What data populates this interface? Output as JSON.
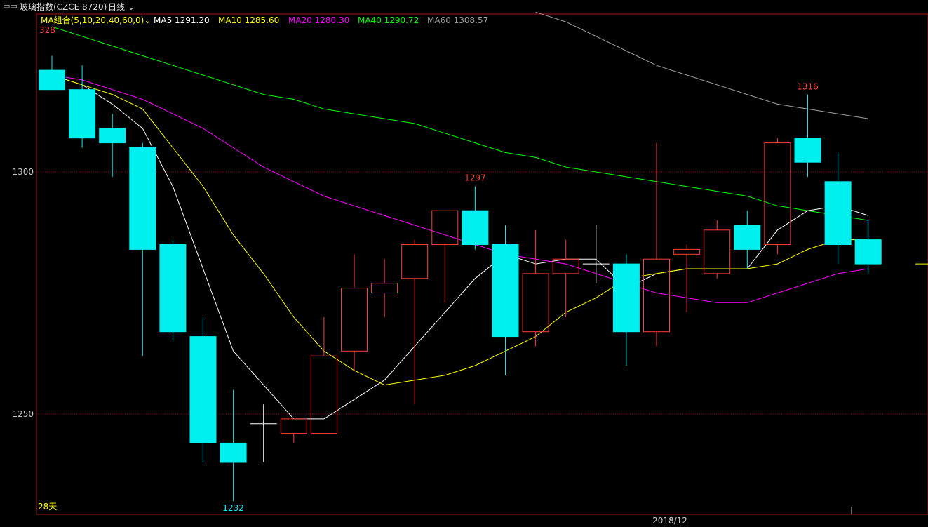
{
  "header": {
    "window_icon": "window-toggle-icon",
    "title": "玻璃指数(CZCE 8720)",
    "period": "日线",
    "dropdown_icon": "chevron-down-icon"
  },
  "legend": {
    "group_label": "MA组合(5,10,20,40,60,0)",
    "items": [
      {
        "label": "MA5 1291.20",
        "color": "#ffffff"
      },
      {
        "label": "MA10 1285.60",
        "color": "#ffff00"
      },
      {
        "label": "MA20 1280.30",
        "color": "#ff00ff"
      },
      {
        "label": "MA40 1290.72",
        "color": "#00ff00"
      },
      {
        "label": "MA60 1308.57",
        "color": "#a0a0a0"
      }
    ]
  },
  "annotations": {
    "top_left_max": "328",
    "peak_1297": "1297",
    "peak_1316": "1316",
    "low_1232": "1232",
    "days": "28天",
    "date_label": "2018/12"
  },
  "colors": {
    "up": "#ff3c3c",
    "down": "#00f0f0",
    "axis": "#a01818",
    "grid": "#a01818",
    "bg": "#000000"
  },
  "chart_data": {
    "type": "candlestick",
    "yticks": [
      1250,
      1300
    ],
    "ylim": [
      1230,
      1335
    ],
    "candles": [
      {
        "o": 1321,
        "h": 1324,
        "l": 1318,
        "c": 1317
      },
      {
        "o": 1317,
        "h": 1322,
        "l": 1305,
        "c": 1307
      },
      {
        "o": 1309,
        "h": 1312,
        "l": 1299,
        "c": 1306
      },
      {
        "o": 1305,
        "h": 1306,
        "l": 1262,
        "c": 1284
      },
      {
        "o": 1285,
        "h": 1286,
        "l": 1265,
        "c": 1267
      },
      {
        "o": 1266,
        "h": 1270,
        "l": 1240,
        "c": 1244
      },
      {
        "o": 1244,
        "h": 1255,
        "l": 1232,
        "c": 1240
      },
      {
        "o": 1248,
        "h": 1252,
        "l": 1240,
        "c": 1248
      },
      {
        "o": 1246,
        "h": 1249,
        "l": 1244,
        "c": 1249
      },
      {
        "o": 1246,
        "h": 1270,
        "l": 1246,
        "c": 1262
      },
      {
        "o": 1263,
        "h": 1283,
        "l": 1259,
        "c": 1276
      },
      {
        "o": 1275,
        "h": 1282,
        "l": 1270,
        "c": 1277
      },
      {
        "o": 1278,
        "h": 1286,
        "l": 1252,
        "c": 1285
      },
      {
        "o": 1285,
        "h": 1292,
        "l": 1273,
        "c": 1292
      },
      {
        "o": 1292,
        "h": 1297,
        "l": 1284,
        "c": 1285
      },
      {
        "o": 1285,
        "h": 1289,
        "l": 1258,
        "c": 1266
      },
      {
        "o": 1267,
        "h": 1288,
        "l": 1264,
        "c": 1279
      },
      {
        "o": 1279,
        "h": 1286,
        "l": 1270,
        "c": 1282
      },
      {
        "o": 1281,
        "h": 1289,
        "l": 1277,
        "c": 1281
      },
      {
        "o": 1281,
        "h": 1283,
        "l": 1260,
        "c": 1267
      },
      {
        "o": 1267,
        "h": 1306,
        "l": 1264,
        "c": 1282
      },
      {
        "o": 1283,
        "h": 1285,
        "l": 1271,
        "c": 1284
      },
      {
        "o": 1279,
        "h": 1290,
        "l": 1278,
        "c": 1288
      },
      {
        "o": 1289,
        "h": 1292,
        "l": 1280,
        "c": 1284
      },
      {
        "o": 1285,
        "h": 1307,
        "l": 1283,
        "c": 1306
      },
      {
        "o": 1307,
        "h": 1316,
        "l": 1299,
        "c": 1302
      },
      {
        "o": 1298,
        "h": 1304,
        "l": 1281,
        "c": 1285
      },
      {
        "o": 1286,
        "h": 1290,
        "l": 1279,
        "c": 1281
      }
    ],
    "ma": [
      {
        "name": "MA5",
        "color": "#ffffff",
        "values": [
          1320,
          1318,
          1314,
          1309,
          1297,
          1280,
          1263,
          1256,
          1249,
          1249,
          1253,
          1257,
          1264,
          1271,
          1278,
          1283,
          1281,
          1282,
          1282,
          1276,
          1279,
          1280,
          1280,
          1280,
          1288,
          1292,
          1293,
          1291
        ]
      },
      {
        "name": "MA10",
        "color": "#ffff00",
        "values": [
          1320,
          1318,
          1316,
          1313,
          1305,
          1297,
          1287,
          1279,
          1270,
          1263,
          1259,
          1256,
          1257,
          1258,
          1260,
          1263,
          1266,
          1271,
          1274,
          1278,
          1279,
          1280,
          1280,
          1280,
          1281,
          1284,
          1286,
          1286
        ]
      },
      {
        "name": "MA20",
        "color": "#ff00ff",
        "values": [
          1320,
          1319,
          1317,
          1315,
          1312,
          1309,
          1305,
          1301,
          1298,
          1295,
          1293,
          1291,
          1289,
          1287,
          1285,
          1283,
          1282,
          1281,
          1279,
          1277,
          1275,
          1274,
          1273,
          1273,
          1275,
          1277,
          1279,
          1280
        ]
      },
      {
        "name": "MA40",
        "color": "#00ff00",
        "values": [
          1330,
          1328,
          1326,
          1324,
          1322,
          1320,
          1318,
          1316,
          1315,
          1313,
          1312,
          1311,
          1310,
          1308,
          1306,
          1304,
          1303,
          1301,
          1300,
          1299,
          1298,
          1297,
          1296,
          1295,
          1293,
          1292,
          1291,
          1290
        ]
      },
      {
        "name": "MA60",
        "color": "#a0a0a0",
        "start": 16,
        "values": [
          1333,
          1331,
          1328,
          1325,
          1322,
          1320,
          1318,
          1316,
          1314,
          1313,
          1312,
          1311
        ]
      }
    ]
  }
}
